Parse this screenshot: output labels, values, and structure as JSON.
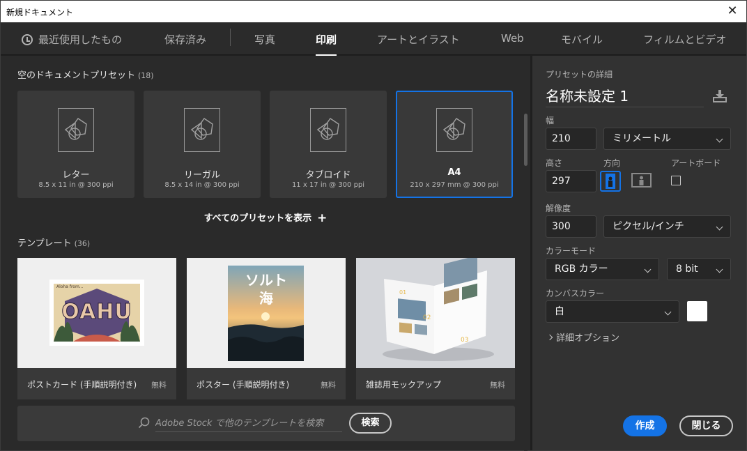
{
  "window": {
    "title": "新規ドキュメント",
    "close_glyph": "✕"
  },
  "tabs": [
    {
      "label": "最近使用したもの",
      "icon": "clock-icon"
    },
    {
      "label": "保存済み"
    },
    {
      "label": "写真"
    },
    {
      "label": "印刷",
      "active": true
    },
    {
      "label": "アートとイラスト"
    },
    {
      "label": "Web"
    },
    {
      "label": "モバイル"
    },
    {
      "label": "フィルムとビデオ"
    }
  ],
  "presets_section": {
    "title": "空のドキュメントプリセット",
    "count": "(18)"
  },
  "presets": [
    {
      "name": "レター",
      "size": "8.5 x 11 in @ 300 ppi"
    },
    {
      "name": "リーガル",
      "size": "8.5 x 14 in @ 300 ppi"
    },
    {
      "name": "タブロイド",
      "size": "11 x 17 in @ 300 ppi"
    },
    {
      "name": "A4",
      "size": "210 x 297 mm @ 300 ppi",
      "selected": true
    }
  ],
  "show_all": {
    "label": "すべてのプリセットを表示",
    "plus": "+"
  },
  "templates_section": {
    "title": "テンプレート",
    "count": "(36)"
  },
  "templates": [
    {
      "name": "ポストカード (手順説明付き)",
      "badge": "無料",
      "thumb_text": "OAHU",
      "thumb_small": "Aloha from..."
    },
    {
      "name": "ポスター (手順説明付き)",
      "badge": "無料",
      "thumb_text": "ソルト",
      "thumb_text2": "海"
    },
    {
      "name": "雑誌用モックアップ",
      "badge": "無料"
    }
  ],
  "search": {
    "placeholder": "Adobe Stock で他のテンプレートを検索",
    "button": "検索"
  },
  "details": {
    "header": "プリセットの詳細",
    "doc_name": "名称未設定 1",
    "width_label": "幅",
    "width_value": "210",
    "width_unit": "ミリメートル",
    "height_label": "高さ",
    "height_value": "297",
    "orientation_label": "方向",
    "artboard_label": "アートボード",
    "resolution_label": "解像度",
    "resolution_value": "300",
    "resolution_unit": "ピクセル/インチ",
    "color_mode_label": "カラーモード",
    "color_mode_value": "RGB カラー",
    "bit_depth": "8 bit",
    "canvas_label": "カンバスカラー",
    "canvas_value": "白",
    "canvas_color": "#ffffff",
    "advanced": "詳細オプション"
  },
  "actions": {
    "create": "作成",
    "close": "閉じる"
  },
  "colors": {
    "accent": "#1473e6",
    "background": "#2a2a2a",
    "panel": "#323232"
  }
}
